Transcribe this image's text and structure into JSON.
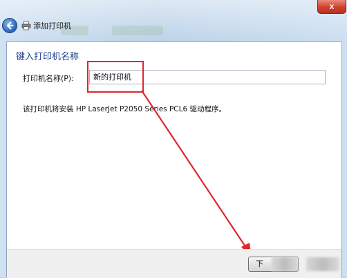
{
  "window": {
    "title": "添加打印机",
    "close_label": "x",
    "icons": {
      "back": "back-arrow-icon",
      "printer": "printer-icon",
      "close": "close-icon"
    },
    "colors": {
      "close": "#d0412c",
      "heading": "#1e3f8c",
      "annotation": "#e0262b"
    }
  },
  "page": {
    "heading": "键入打印机名称",
    "name_label": "打印机名称(P):",
    "name_value": "新的打印机",
    "info_text": "该打印机将安装 HP LaserJet P2050 Series PCL6 驱动程序。"
  },
  "footer": {
    "next_label": "下"
  }
}
